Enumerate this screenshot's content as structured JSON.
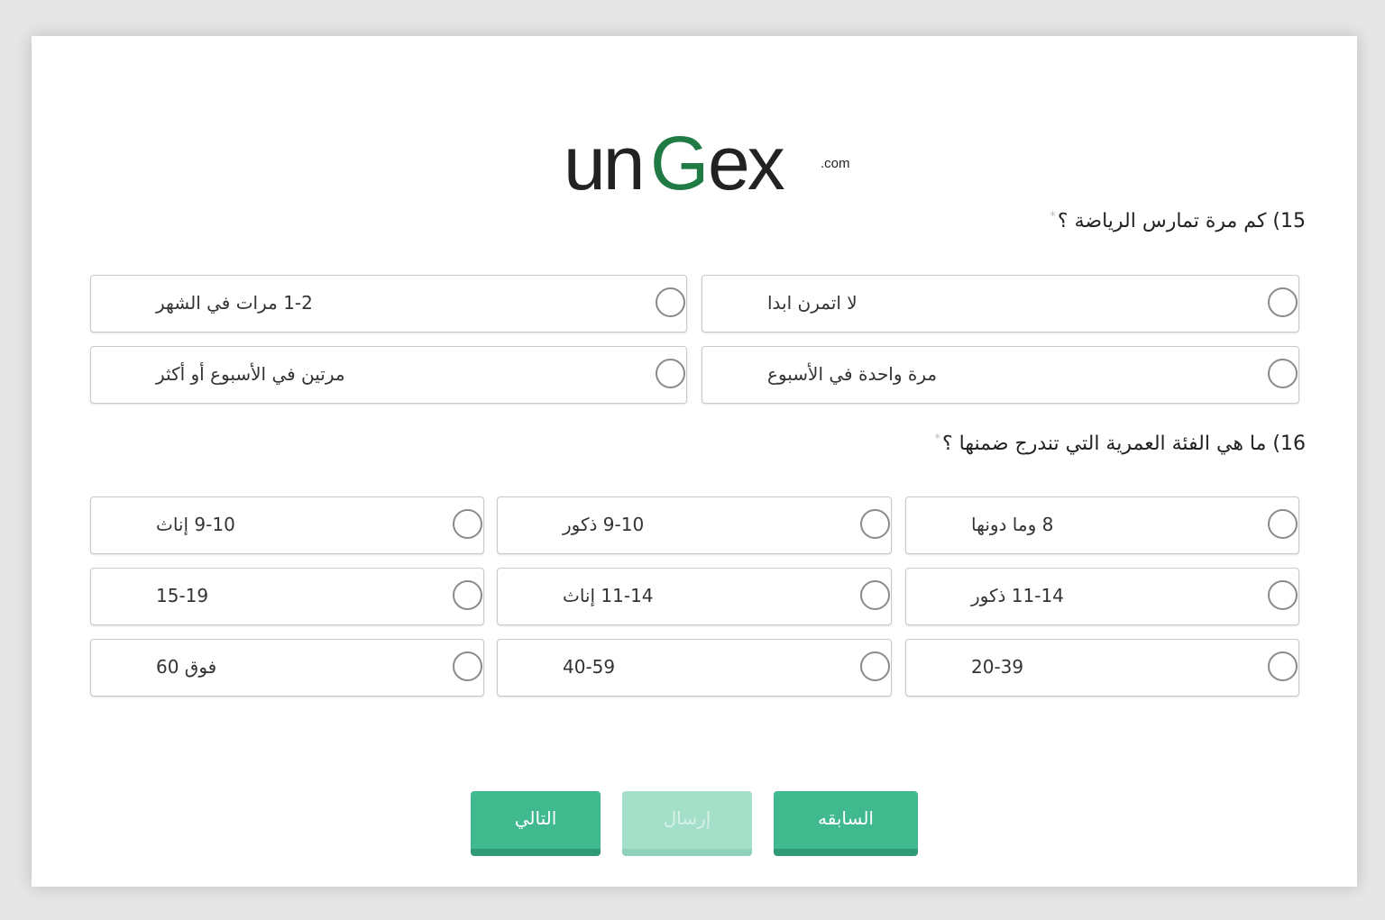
{
  "logo": {
    "text_main": "un",
    "text_g": "G",
    "text_tail": "ex",
    "text_com": ".com",
    "colors": {
      "dark": "#222222",
      "green": "#1f7a44"
    }
  },
  "questions": [
    {
      "title": "15) كم مرة تمارس الرياضة ؟",
      "required_mark": "*",
      "options": [
        "لا اتمرن ابدا",
        "1-2 مرات في الشهر",
        "مرة واحدة في الأسبوع",
        "مرتين في الأسبوع أو أكثر"
      ]
    },
    {
      "title": "16) ما هي الفئة العمرية التي تندرج ضمنها ؟",
      "required_mark": "*",
      "options": [
        "8 وما دونها",
        "9-10 ذكور",
        "9-10 إناث",
        "11-14 ذكور",
        "11-14 إناث",
        "15-19",
        "20-39",
        "40-59",
        "فوق 60"
      ]
    }
  ],
  "buttons": {
    "previous": "السابقه",
    "submit": "إرسال",
    "next": "التالي"
  },
  "colors": {
    "accent": "#40b98f",
    "accent_dark": "#2f9a75",
    "disabled": "#a3dfc9"
  }
}
